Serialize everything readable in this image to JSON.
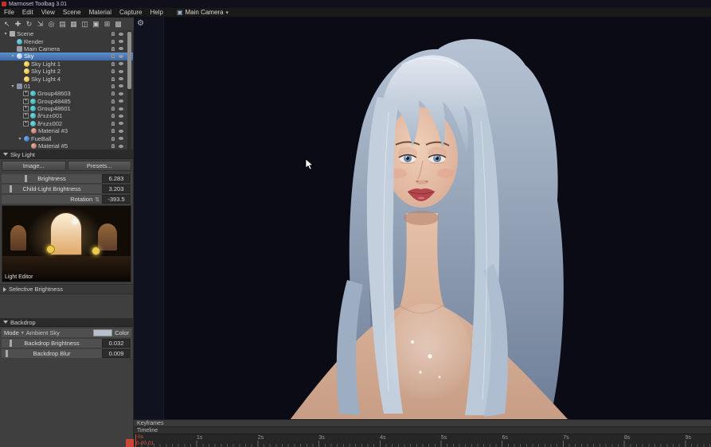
{
  "window": {
    "title": "Marmoset Toolbag 3.01"
  },
  "menubar": {
    "items": [
      "File",
      "Edit",
      "View",
      "Scene",
      "Material",
      "Capture",
      "Help"
    ],
    "camera": "Main Camera",
    "camera_icon_glyph": "▣",
    "caret_glyph": "▾"
  },
  "toolbar": {
    "icons": [
      {
        "name": "select-tool-icon",
        "glyph": "↖"
      },
      {
        "name": "move-tool-icon",
        "glyph": "✚"
      },
      {
        "name": "rotate-tool-icon",
        "glyph": "↻"
      },
      {
        "name": "scale-tool-icon",
        "glyph": "⇲"
      },
      {
        "name": "pivot-tool-icon",
        "glyph": "◎"
      },
      {
        "name": "new-scene-icon",
        "glyph": "▤"
      },
      {
        "name": "open-file-icon",
        "glyph": "▦"
      },
      {
        "name": "save-file-icon",
        "glyph": "◫"
      },
      {
        "name": "import-model-icon",
        "glyph": "▣"
      },
      {
        "name": "add-object-icon",
        "glyph": "⊞"
      },
      {
        "name": "delete-object-icon",
        "glyph": "▩"
      }
    ]
  },
  "viewport": {
    "gear_glyph": "⚙"
  },
  "scene_tree": {
    "rows": [
      {
        "label": "Scene",
        "depth": 0,
        "icon": "scene",
        "expander": "open"
      },
      {
        "label": "Render",
        "depth": 1,
        "icon": "render",
        "expander": "none"
      },
      {
        "label": "Main Camera",
        "depth": 1,
        "icon": "camera",
        "expander": "none"
      },
      {
        "label": "Sky",
        "depth": 1,
        "icon": "sky",
        "expander": "open",
        "selected": true
      },
      {
        "label": "Sky Light 1",
        "depth": 2,
        "icon": "light",
        "expander": "none"
      },
      {
        "label": "Sky Light 2",
        "depth": 2,
        "icon": "light",
        "expander": "none"
      },
      {
        "label": "Sky Light 4",
        "depth": 2,
        "icon": "light",
        "expander": "none"
      },
      {
        "label": "01",
        "depth": 1,
        "icon": "object",
        "expander": "open"
      },
      {
        "label": "Group48603",
        "depth": 2,
        "icon": "group",
        "expander": "none",
        "plus": true
      },
      {
        "label": "Group48485",
        "depth": 2,
        "icon": "group",
        "expander": "none",
        "plus": true
      },
      {
        "label": "Group48601",
        "depth": 2,
        "icon": "group",
        "expander": "none",
        "plus": true
      },
      {
        "label": "å²±z±001",
        "depth": 2,
        "icon": "mesh",
        "expander": "none",
        "plus": true
      },
      {
        "label": "å²±z±002",
        "depth": 2,
        "icon": "mesh",
        "expander": "none",
        "plus": true
      },
      {
        "label": "Material #3",
        "depth": 3,
        "icon": "material",
        "expander": "none"
      },
      {
        "label": "FueBall",
        "depth": 2,
        "icon": "fueball",
        "expander": "open"
      },
      {
        "label": "Material #5",
        "depth": 3,
        "icon": "material",
        "expander": "none"
      }
    ]
  },
  "sky_light_panel": {
    "title": "Sky Light",
    "image_button": "Image...",
    "presets_button": "Presets...",
    "sliders": [
      {
        "label": "Brightness",
        "value": "6.283",
        "handle_pct": 18
      },
      {
        "label": "Child-Light Brightness",
        "value": "3.203",
        "handle_pct": 6
      }
    ],
    "rotation": {
      "label": "Rotation",
      "value": "-393.5",
      "spinner_glyph": "⇅"
    },
    "light_editor_label": "Light Editor",
    "selective_brightness_label": "Selective Brightness"
  },
  "backdrop_panel": {
    "title": "Backdrop",
    "mode_label": "Mode",
    "mode_value": "Ambient Sky",
    "color_label": "Color",
    "color_swatch_hex": "#b6c0ce",
    "sliders": [
      {
        "label": "Backdrop Brightness",
        "value": "0.032",
        "handle_pct": 6
      },
      {
        "label": "Backdrop Blur",
        "value": "0.009",
        "handle_pct": 3
      }
    ]
  },
  "timeline": {
    "keyframes_label": "Keyframes",
    "timeline_label": "Timeline",
    "ticks": [
      "1s",
      "2s",
      "3s",
      "4s",
      "5s",
      "6s",
      "7s",
      "8s",
      "9s"
    ],
    "playhead_time": "0s",
    "playhead_frame": "0-00.01"
  },
  "colors": {
    "selection_blue": "#4a7ab8",
    "viewport_bg": "#0a0b15",
    "panel_bg": "#3f3f3f",
    "accent_red": "#cc4633"
  }
}
